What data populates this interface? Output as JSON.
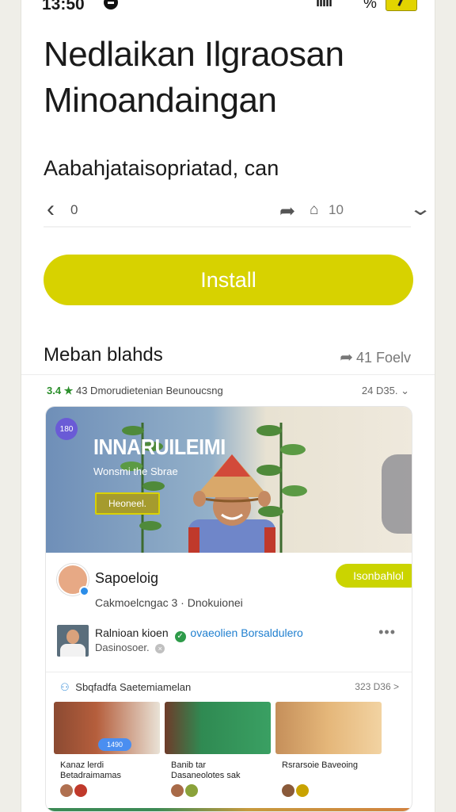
{
  "status_bar": {
    "time": "13:50",
    "signal": "ıılıl",
    "percent": "%"
  },
  "page": {
    "title_line1": "Nedlaikan Ilgraosan",
    "title_line2": "Minoandaingan",
    "subtitle": "Aabahjataisopriatad, can"
  },
  "action_bar": {
    "back_count": "0",
    "save_count": "10"
  },
  "install_label": "Install",
  "section": {
    "heading": "Meban blahds",
    "right_label": "41 Foelv",
    "meta_rating": "3.4",
    "meta_text": "43 Dmorudietenian Beunoucsng",
    "meta_right": "24 D35."
  },
  "banner": {
    "badge": "180",
    "title": "INNARUILEIMI",
    "subtitle": "Wonsmi the Sbrae",
    "button": "Heoneel."
  },
  "publisher": {
    "name": "Sapoeloig",
    "follow": "Isonbahlol",
    "description": "Cakmoelcngac 3 · Dnokuionei"
  },
  "comment": {
    "author": "Ralnioan kioen",
    "link": "ovaeolien Borsaldulero",
    "sub": "Dasinosoer.",
    "more": "•••"
  },
  "related": {
    "heading": "Sbqfadfa Saetemiamelan",
    "right": "323 D36 >",
    "items": [
      {
        "line1": "Kanaz lerdi",
        "line2": "Betadraimamas",
        "pill": "1490"
      },
      {
        "line1": "Banib tar",
        "line2": "Dasaneolotes sak"
      },
      {
        "line1": "Rsrarsoie Baveoing",
        "line2": ""
      }
    ]
  },
  "icons": {
    "back": "chevron-left-icon",
    "share": "share-icon",
    "save": "bookmark-icon",
    "expand": "chevron-down-icon",
    "star": "star-icon",
    "verified": "verified-icon"
  },
  "colors": {
    "accent": "#d7d200",
    "link": "#1f7fcf",
    "verified": "#2b8de8"
  }
}
